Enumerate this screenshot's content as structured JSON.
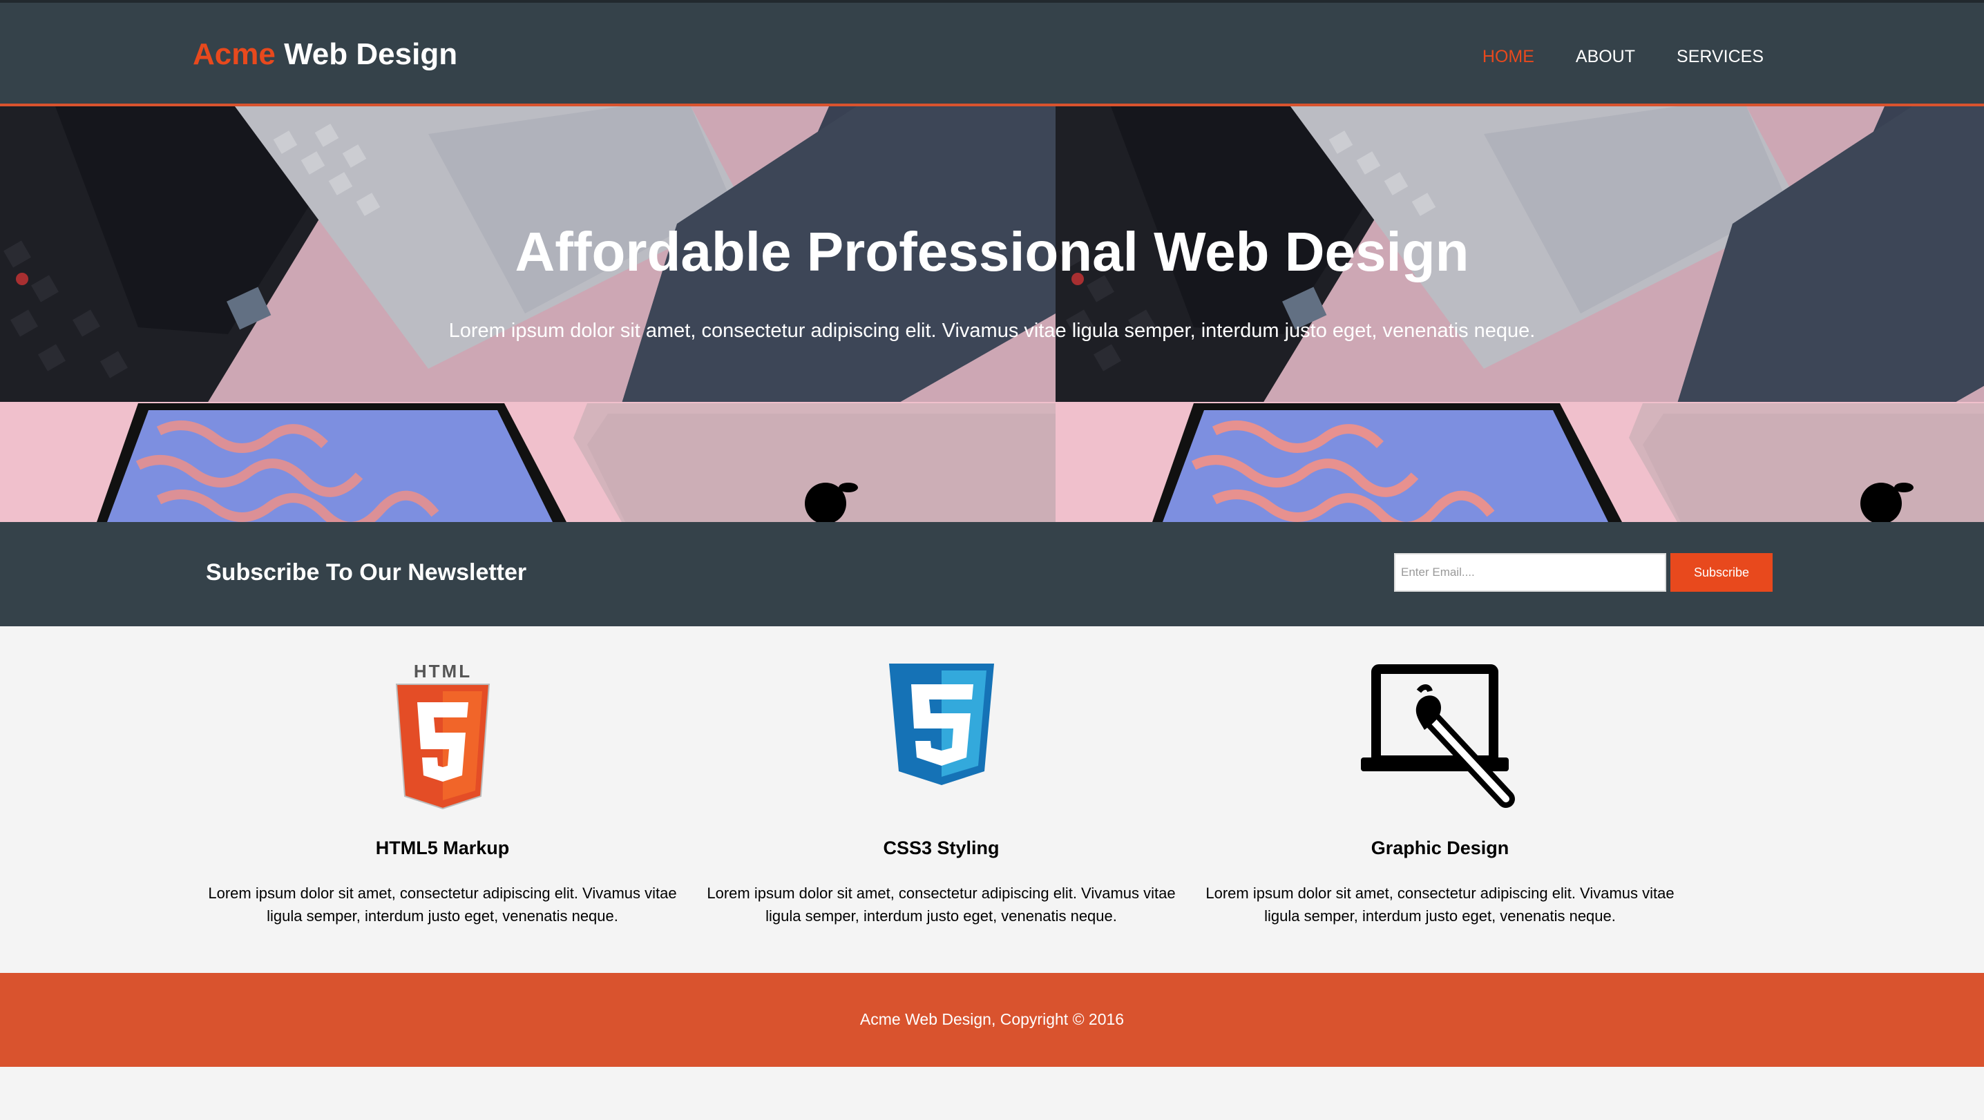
{
  "header": {
    "logo_highlight": "Acme",
    "logo_rest": " Web Design",
    "nav": [
      {
        "label": "Home",
        "current": true
      },
      {
        "label": "About",
        "current": false
      },
      {
        "label": "Services",
        "current": false
      }
    ]
  },
  "showcase": {
    "title": "Affordable Professional Web Design",
    "subtitle": "Lorem ipsum dolor sit amet, consectetur adipiscing elit. Vivamus vitae ligula semper, interdum justo eget, venenatis neque."
  },
  "newsletter": {
    "title": "Subscribe To Our Newsletter",
    "email_placeholder": "Enter Email....",
    "button_label": "Subscribe"
  },
  "boxes": [
    {
      "icon": "html5-logo-icon",
      "title": "HTML5 Markup",
      "text": "Lorem ipsum dolor sit amet, consectetur adipiscing elit. Vivamus vitae ligula semper, interdum justo eget, venenatis neque."
    },
    {
      "icon": "css3-logo-icon",
      "title": "CSS3 Styling",
      "text": "Lorem ipsum dolor sit amet, consectetur adipiscing elit. Vivamus vitae ligula semper, interdum justo eget, venenatis neque."
    },
    {
      "icon": "graphic-design-icon",
      "title": "Graphic Design",
      "text": "Lorem ipsum dolor sit amet, consectetur adipiscing elit. Vivamus vitae ligula semper, interdum justo eget, venenatis neque."
    }
  ],
  "footer": {
    "text": "Acme Web Design, Copyright © 2016"
  },
  "colors": {
    "header_bg": "#35424a",
    "accent": "#e8491d",
    "footer_bg": "#d9532e",
    "body_bg": "#f4f4f4"
  }
}
